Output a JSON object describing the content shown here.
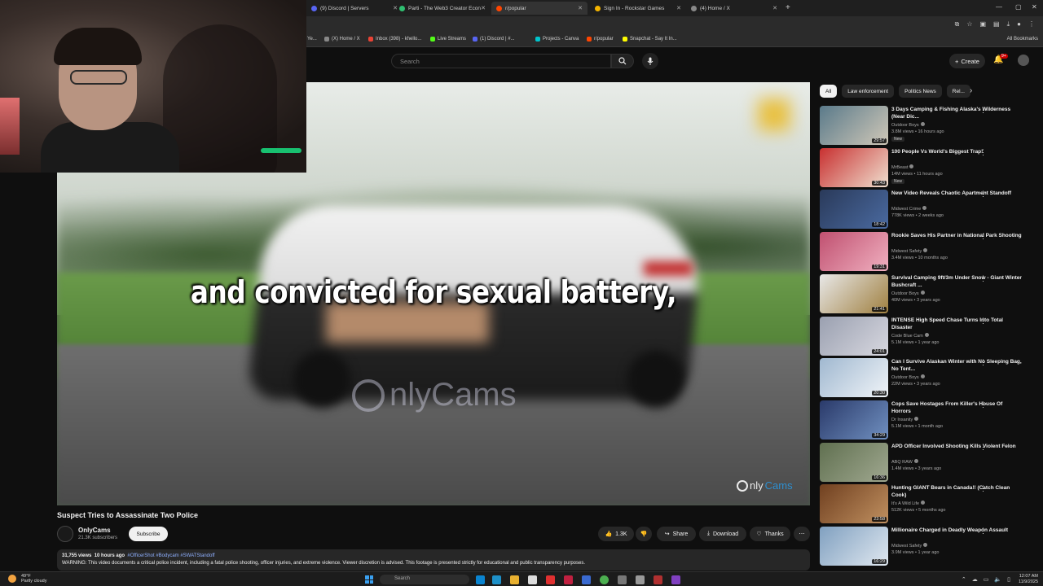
{
  "browser": {
    "tabs": [
      {
        "label": "(9) Discord | Servers",
        "color": "#5865f2"
      },
      {
        "label": "Parti - The Web3 Creator Econ",
        "color": "#2fbf71"
      },
      {
        "label": "r/popular",
        "color": "#ff4500"
      },
      {
        "label": "Sign In - Rockstar Games",
        "color": "#f4b400"
      },
      {
        "label": "(4) Home / X",
        "color": "#888888"
      }
    ],
    "bookmarks": [
      {
        "label": "Ye...",
        "color": "#888888"
      },
      {
        "label": "(X) Home / X",
        "color": "#888888"
      },
      {
        "label": "Inbox (398) - khello...",
        "color": "#ea4335"
      },
      {
        "label": "Live Streams",
        "color": "#53fc18"
      },
      {
        "label": "(1) Discord | #...",
        "color": "#5865f2"
      },
      {
        "label": "Projects - Canva",
        "color": "#00c4cc"
      },
      {
        "label": "r/popular",
        "color": "#ff4500"
      },
      {
        "label": "Snapchat - Say It In...",
        "color": "#fffc00"
      }
    ],
    "all_bookmarks": "All Bookmarks"
  },
  "header": {
    "search_placeholder": "Search",
    "create_label": "Create",
    "notif_count": "9+"
  },
  "player": {
    "caption": "and convicted for sexual battery,",
    "watermark_center": "nlyCams",
    "watermark_corner_a": "nly",
    "watermark_corner_b": "Cams"
  },
  "video": {
    "title": "Suspect Tries to Assassinate Two Police",
    "channel": "OnlyCams",
    "subscribers": "21.3K subscribers",
    "subscribe_label": "Subscribe",
    "likes": "1.3K",
    "share_label": "Share",
    "download_label": "Download",
    "thanks_label": "Thanks",
    "views": "31,755 views",
    "age": "10 hours ago",
    "tags": "#OfficerShot #Bodycam #SWATStandoff",
    "description": "WARNING: This video documents a critical police incident, including a fatal police shooting, officer injuries, and extreme violence. Viewer discretion is advised. This footage is presented strictly for educational and public transparency purposes."
  },
  "chips": [
    "All",
    "Law enforcement",
    "Politics News",
    "Rel..."
  ],
  "recommendations": [
    {
      "title": "3 Days Camping & Fishing Alaska's Wilderness (Near Dic...",
      "channel": "Outdoor Boys",
      "meta": "3.8M views • 16 hours ago",
      "new": "New",
      "duration": "29:57",
      "colors": [
        "#5a7a8a",
        "#d0c8b8"
      ]
    },
    {
      "title": "100 People Vs World's Biggest Trap!",
      "channel": "MrBeast",
      "meta": "14M views • 11 hours ago",
      "new": "New",
      "duration": "30:43",
      "colors": [
        "#c83030",
        "#f0e0d0"
      ]
    },
    {
      "title": "New Video Reveals Chaotic Apartment Standoff",
      "channel": "Midwest Crime",
      "meta": "778K views • 2 weeks ago",
      "new": "",
      "duration": "18:42",
      "colors": [
        "#2a3a5a",
        "#4a6aa0"
      ]
    },
    {
      "title": "Rookie Saves His Partner in National Park Shooting",
      "channel": "Midwest Safety",
      "meta": "3.4M views • 10 months ago",
      "new": "",
      "duration": "19:31",
      "colors": [
        "#c05070",
        "#f0b0c0"
      ]
    },
    {
      "title": "Survival Camping 9ft/3m Under Snow - Giant Winter Bushcraft ...",
      "channel": "Outdoor Boys",
      "meta": "40M views • 3 years ago",
      "new": "",
      "duration": "21:41",
      "colors": [
        "#e8e8e8",
        "#a08040"
      ]
    },
    {
      "title": "INTENSE High Speed Chase Turns Into Total Disaster",
      "channel": "Code Blue Cam",
      "meta": "5.1M views • 1 year ago",
      "new": "",
      "duration": "24:01",
      "colors": [
        "#9aa0b0",
        "#d8d8e0"
      ]
    },
    {
      "title": "Can I Survive Alaskan Winter with No Sleeping Bag, No Tent...",
      "channel": "Outdoor Boys",
      "meta": "22M views • 3 years ago",
      "new": "",
      "duration": "20:30",
      "colors": [
        "#a0b8d0",
        "#f0f4f8"
      ]
    },
    {
      "title": "Cops Save Hostages From Killer's House Of Horrors",
      "channel": "Dr Insanity",
      "meta": "5.1M views • 1 month ago",
      "new": "",
      "duration": "34:29",
      "colors": [
        "#2a3a6a",
        "#7090c0"
      ]
    },
    {
      "title": "APD Officer Involved Shooting Kills Violent Felon",
      "channel": "ABQ RAW",
      "meta": "1.4M views • 3 years ago",
      "new": "",
      "duration": "16:36",
      "colors": [
        "#607050",
        "#a0a890"
      ]
    },
    {
      "title": "Hunting GIANT Bears in Canada!! (Catch Clean Cook)",
      "channel": "It's A Wild Life",
      "meta": "512K views • 5 months ago",
      "new": "",
      "duration": "23:58",
      "colors": [
        "#704020",
        "#c09060"
      ]
    },
    {
      "title": "Millionaire Charged in Deadly Weapon Assault",
      "channel": "Midwest Safety",
      "meta": "3.9M views • 1 year ago",
      "new": "",
      "duration": "16:29",
      "colors": [
        "#80a0c0",
        "#e0e8f0"
      ]
    }
  ],
  "taskbar": {
    "temp": "49°F",
    "weather": "Partly cloudy",
    "search": "Search",
    "time": "12:07 AM",
    "date": "11/9/2025"
  }
}
